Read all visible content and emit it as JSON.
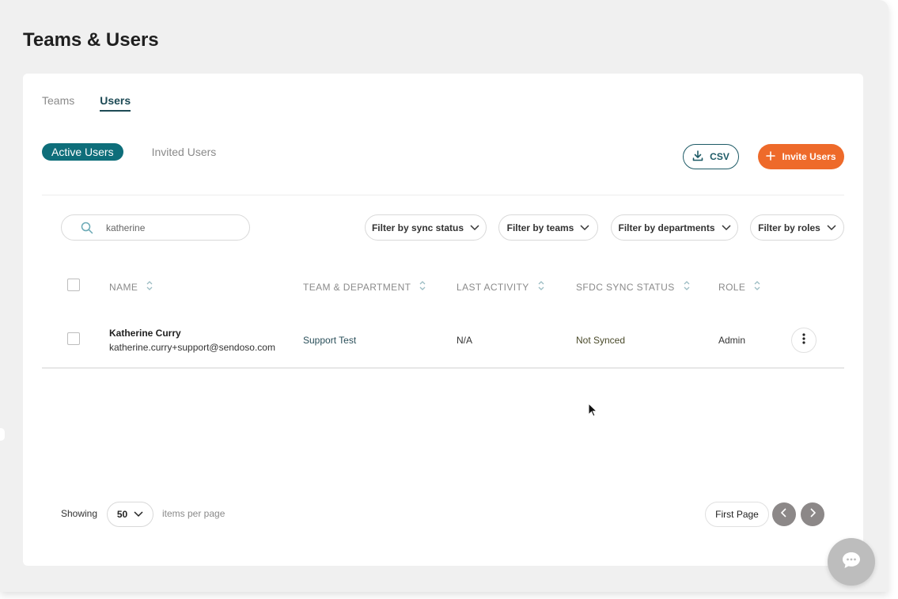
{
  "page": {
    "title": "Teams & Users"
  },
  "tabs": [
    {
      "label": "Teams",
      "active": false
    },
    {
      "label": "Users",
      "active": true
    }
  ],
  "segments": {
    "active_label": "Active Users",
    "invited_label": "Invited Users"
  },
  "actions": {
    "csv_label": "CSV",
    "invite_label": "Invite Users"
  },
  "search": {
    "value": "katherine",
    "icon": "search-icon"
  },
  "filters": [
    {
      "label": "Filter by sync status"
    },
    {
      "label": "Filter by teams"
    },
    {
      "label": "Filter by departments"
    },
    {
      "label": "Filter by roles"
    }
  ],
  "table": {
    "columns": [
      "NAME",
      "TEAM & DEPARTMENT",
      "LAST ACTIVITY",
      "SFDC SYNC STATUS",
      "ROLE"
    ],
    "rows": [
      {
        "name": "Katherine Curry",
        "email": "katherine.curry+support@sendoso.com",
        "team": "Support Test",
        "last_activity": "N/A",
        "sync_status": "Not Synced",
        "role": "Admin"
      }
    ]
  },
  "pagination": {
    "showing_label": "Showing",
    "per_page_value": "50",
    "per_page_suffix": "items per page",
    "first_page_label": "First Page"
  },
  "colors": {
    "accent": "#0e6e7a",
    "primary_action": "#ee6a2a",
    "nav_button": "#8c8888"
  }
}
